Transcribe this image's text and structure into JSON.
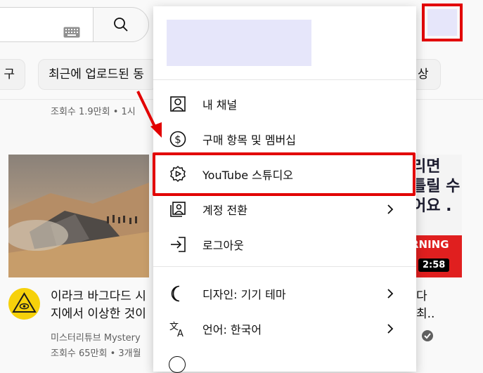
{
  "search": {
    "keyboard_icon": "keyboard-icon",
    "search_icon": "search-icon"
  },
  "chips": {
    "left_partial": "구",
    "middle": "최근에 업로드된 동",
    "right_partial": "상"
  },
  "feed": {
    "top_meta": "조회수 1.9만회 • 1시",
    "left_video": {
      "title_line1": "이라크 바그다드 시",
      "title_line2": "지에서 이상한 것이",
      "channel": "미스터리튜브 Mystery",
      "meta": "조회수 65만회 • 3개월"
    },
    "right_video": {
      "thumb_text_line1": "리면",
      "thumb_text_line2": "틀릴 수",
      "thumb_text_line3": "어요 .",
      "band_text": "RNING",
      "duration": "2:58",
      "title_line1": "다",
      "title_line2": "최.."
    }
  },
  "menu": {
    "items": [
      {
        "label": "내 채널",
        "icon": "person-icon"
      },
      {
        "label": "구매 항목 및 멤버십",
        "icon": "dollar-icon"
      },
      {
        "label": "YouTube 스튜디오",
        "icon": "studio-gear-icon"
      },
      {
        "label": "계정 전환",
        "icon": "switch-account-icon"
      },
      {
        "label": "로그아웃",
        "icon": "sign-out-icon"
      },
      {
        "label": "디자인: 기기 테마",
        "icon": "moon-icon"
      },
      {
        "label": "언어: 한국어",
        "icon": "translate-icon"
      }
    ]
  },
  "colors": {
    "highlight": "#e20000",
    "avatar_placeholder": "#e6e6fa"
  }
}
